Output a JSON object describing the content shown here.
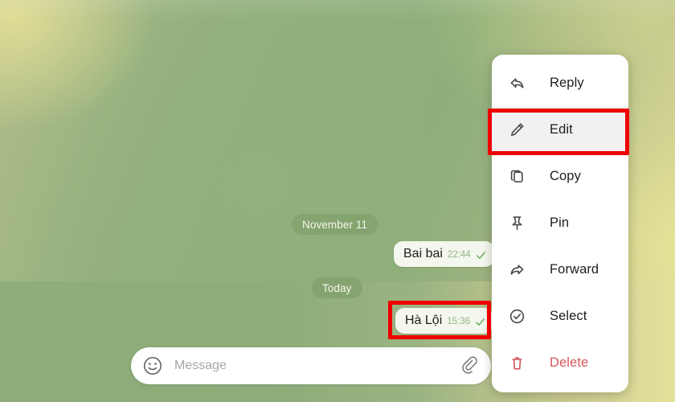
{
  "app": {
    "name": "Telegram chat",
    "wallpaper_colors": {
      "green": "#8cae79",
      "yellow": "#e4e19c",
      "olive": "#b6bf8c"
    }
  },
  "chat": {
    "date_separators": [
      {
        "id": "november",
        "label": "November 11"
      },
      {
        "id": "today",
        "label": "Today"
      }
    ],
    "messages": [
      {
        "id": "baibai",
        "text": "Bai bai",
        "time": "22:44",
        "status_icon": "single-check-icon",
        "outgoing": true
      },
      {
        "id": "haloi",
        "text": "Hà Lội",
        "time": "15:36",
        "status_icon": "single-check-icon",
        "outgoing": true,
        "selected": true
      }
    ]
  },
  "context_menu": {
    "items": [
      {
        "label": "Reply",
        "icon": "reply-arrow-icon",
        "highlighted": false,
        "danger": false
      },
      {
        "label": "Edit",
        "icon": "pencil-icon",
        "highlighted": true,
        "danger": false
      },
      {
        "label": "Copy",
        "icon": "copy-icon",
        "highlighted": false,
        "danger": false
      },
      {
        "label": "Pin",
        "icon": "pin-icon",
        "highlighted": false,
        "danger": false
      },
      {
        "label": "Forward",
        "icon": "forward-arrow-icon",
        "highlighted": false,
        "danger": false
      },
      {
        "label": "Select",
        "icon": "check-circle-icon",
        "highlighted": false,
        "danger": false
      },
      {
        "label": "Delete",
        "icon": "trash-icon",
        "highlighted": false,
        "danger": true
      }
    ]
  },
  "composer": {
    "placeholder": "Message",
    "value": "",
    "emoji_icon": "smiley-icon",
    "attach_icon": "paperclip-icon"
  },
  "annotations": {
    "color": "#ee0000",
    "boxes": [
      {
        "id": "redbox-haloi",
        "targets": "message-bubble-haloi"
      },
      {
        "id": "redbox-edit",
        "targets": "menu-item-edit"
      }
    ]
  }
}
